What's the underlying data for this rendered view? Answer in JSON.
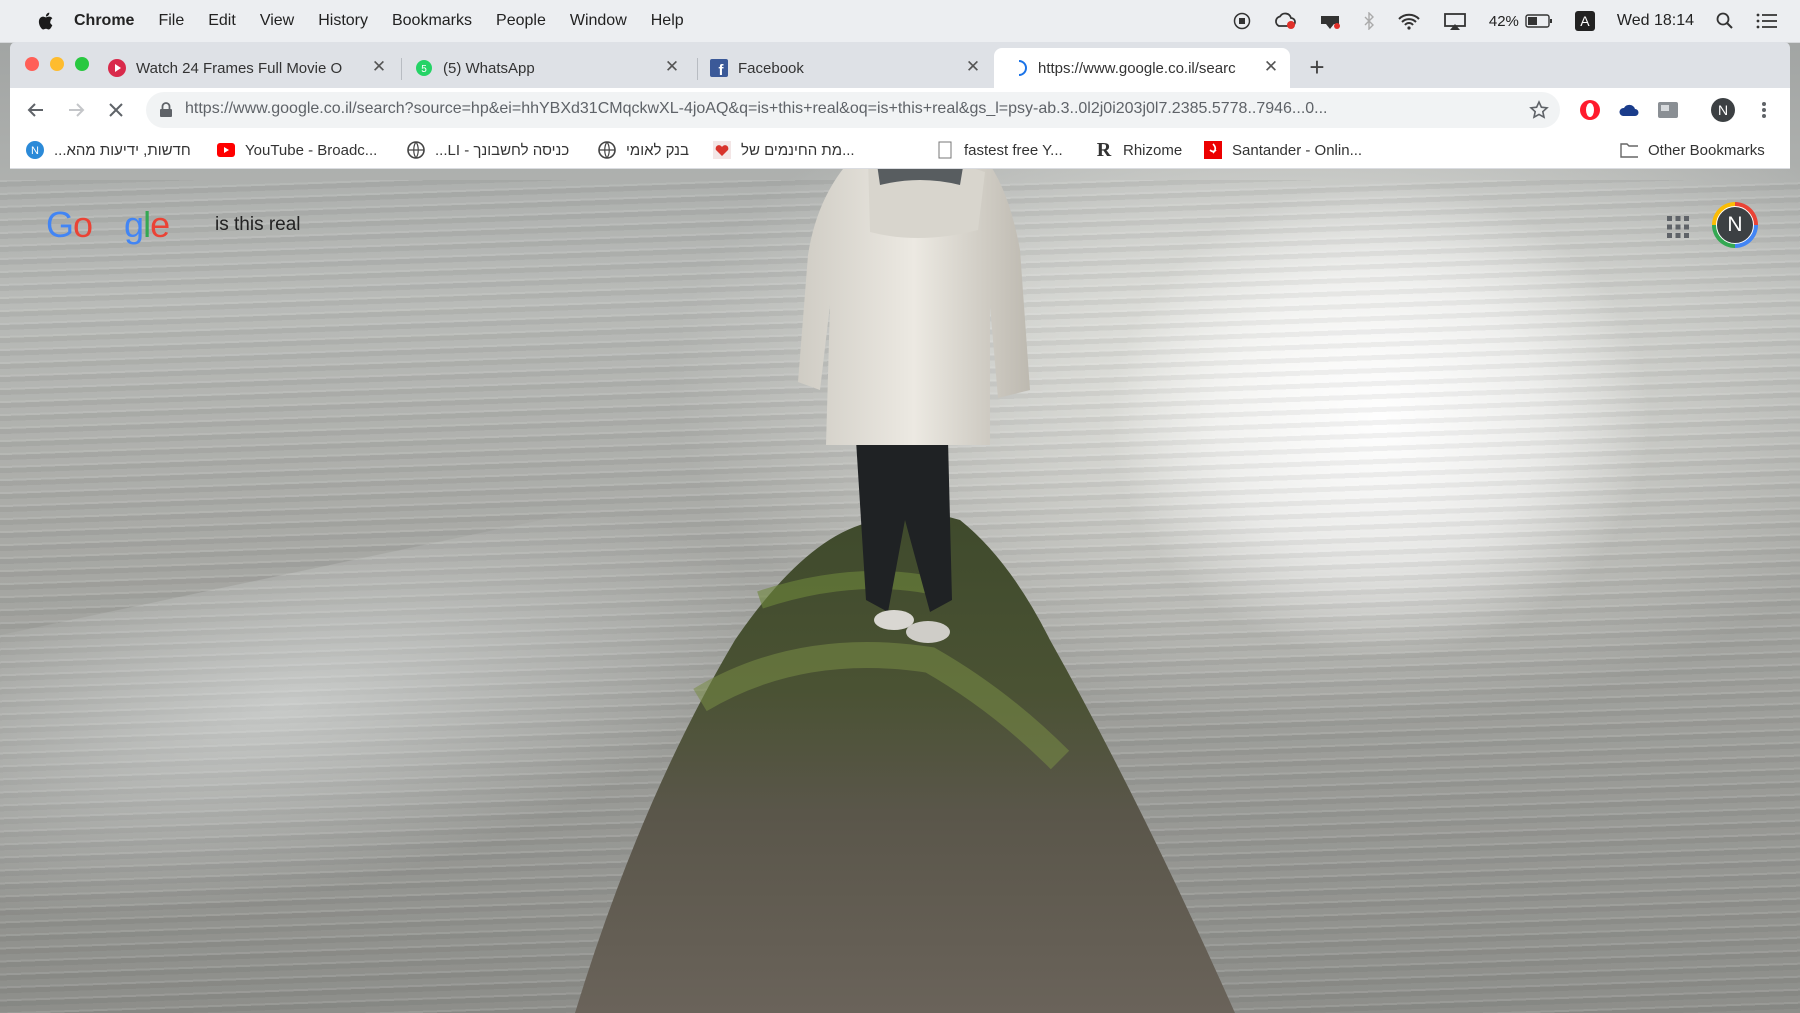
{
  "menubar": {
    "app": "Chrome",
    "items": [
      "File",
      "Edit",
      "View",
      "History",
      "Bookmarks",
      "People",
      "Window",
      "Help"
    ],
    "battery": "42%",
    "clock": "Wed 18:14",
    "input_source": "A"
  },
  "tabs": [
    {
      "title": "Watch 24 Frames Full Movie O",
      "icon": "play-icon",
      "active": false
    },
    {
      "title": "(5) WhatsApp",
      "icon": "whatsapp-icon",
      "active": false
    },
    {
      "title": "Facebook",
      "icon": "facebook-icon",
      "active": false
    },
    {
      "title": "https://www.google.co.il/searc",
      "icon": "loading-spinner-icon",
      "active": true
    }
  ],
  "toolbar": {
    "url": "https://www.google.co.il/search?source=hp&ei=hhYBXd31CMqckwXL-4joAQ&q=is+this+real&oq=is+this+real&gs_l=psy-ab.3..0l2j0i203j0l7.2385.5778..7946...0...",
    "profile_initial": "N"
  },
  "bookmarks": [
    {
      "label": "חדשות, ידיעות מהא...",
      "icon": "news-icon"
    },
    {
      "label": "YouTube - Broadc...",
      "icon": "youtube-icon"
    },
    {
      "label": "כניסה לחשבונך - LI...",
      "icon": "globe-icon"
    },
    {
      "label": "בנק לאומי",
      "icon": "globe-icon"
    },
    {
      "label": "...מת החינמים של",
      "icon": "heart-icon"
    },
    {
      "label": "fastest free Y...",
      "icon": "page-icon"
    },
    {
      "label": "Rhizome",
      "icon": "rhizome-icon"
    },
    {
      "label": "Santander - Onlin...",
      "icon": "santander-icon"
    },
    {
      "label": "Other Bookmarks",
      "icon": "folder-icon"
    }
  ],
  "google": {
    "query": "is this real",
    "avatar_initial": "N"
  },
  "colors": {
    "chrome_frame": "#dee1e6",
    "close_red": "#ff5f57",
    "minimize_yellow": "#febc2e",
    "zoom_green": "#28c840",
    "google_blue": "#4285f4",
    "google_red": "#ea4335",
    "google_yellow": "#fbbc05",
    "google_green": "#34a853"
  }
}
